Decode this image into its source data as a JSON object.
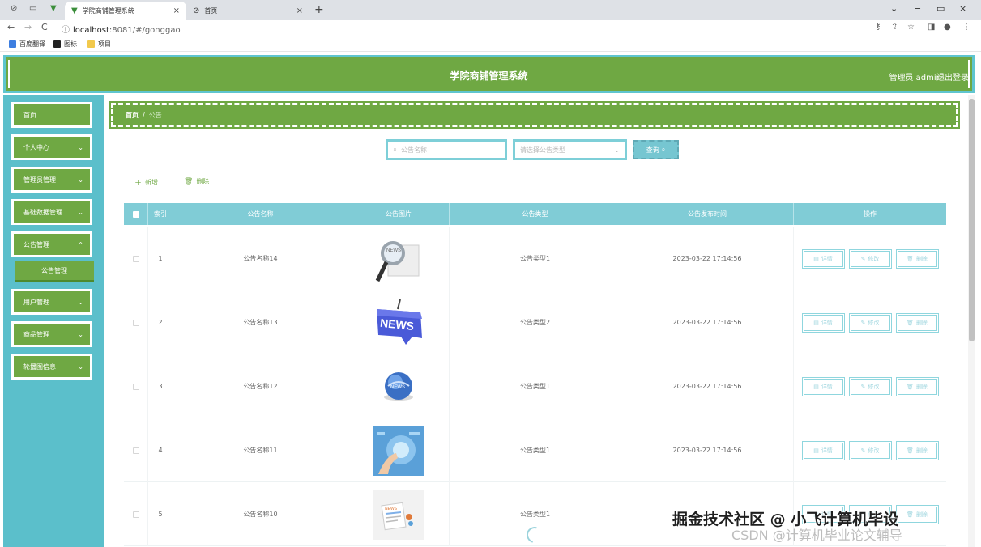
{
  "browser": {
    "tabs": [
      {
        "label": "学院商铺管理系统",
        "active": true
      },
      {
        "label": "首页",
        "active": false
      }
    ],
    "url_host": "localhost",
    "url_path": ":8081/#/gonggao",
    "bookmarks": [
      "百度翻译",
      "图标",
      "项目"
    ]
  },
  "header": {
    "title": "学院商铺管理系统",
    "user": "管理员 admin",
    "logout": "退出登录"
  },
  "sidebar": {
    "items": [
      {
        "label": "首页",
        "has_children": false
      },
      {
        "label": "个人中心",
        "has_children": true
      },
      {
        "label": "管理员管理",
        "has_children": true
      },
      {
        "label": "基础数据管理",
        "has_children": true
      },
      {
        "label": "公告管理",
        "has_children": true,
        "expanded": true
      },
      {
        "label": "用户管理",
        "has_children": true
      },
      {
        "label": "商品管理",
        "has_children": true
      },
      {
        "label": "轮播图信息",
        "has_children": true
      }
    ],
    "submenu": {
      "label": "公告管理"
    }
  },
  "breadcrumb": {
    "home": "首页",
    "separator": "/",
    "current": "公告"
  },
  "search": {
    "name_placeholder": "公告名称",
    "type_placeholder": "请选择公告类型",
    "query_label": "查询"
  },
  "actions": {
    "add": "新增",
    "delete": "删除"
  },
  "table": {
    "columns": [
      "索引",
      "公告名称",
      "公告图片",
      "公告类型",
      "公告发布时间",
      "操作"
    ],
    "rows": [
      {
        "index": "1",
        "name": "公告名称14",
        "image": "magnifier-news-icon",
        "type": "公告类型1",
        "time": "2023-03-22 17:14:56"
      },
      {
        "index": "2",
        "name": "公告名称13",
        "image": "news-sign-icon",
        "type": "公告类型2",
        "time": "2023-03-22 17:14:56"
      },
      {
        "index": "3",
        "name": "公告名称12",
        "image": "globe-icon",
        "type": "公告类型1",
        "time": "2023-03-22 17:14:56"
      },
      {
        "index": "4",
        "name": "公告名称11",
        "image": "tech-hand-icon",
        "type": "公告类型1",
        "time": "2023-03-22 17:14:56"
      },
      {
        "index": "5",
        "name": "公告名称10",
        "image": "news-document-icon",
        "type": "公告类型1",
        "time": ""
      }
    ],
    "row_actions": {
      "detail": "详情",
      "edit": "修改",
      "delete": "删除"
    }
  },
  "watermark": {
    "primary": "掘金技术社区 @ 小飞计算机毕设",
    "secondary": "CSDN @计算机毕业论文辅导"
  },
  "colors": {
    "green": "#6fa843",
    "teal": "#5bbfcb",
    "table_header": "#80ccd6"
  }
}
